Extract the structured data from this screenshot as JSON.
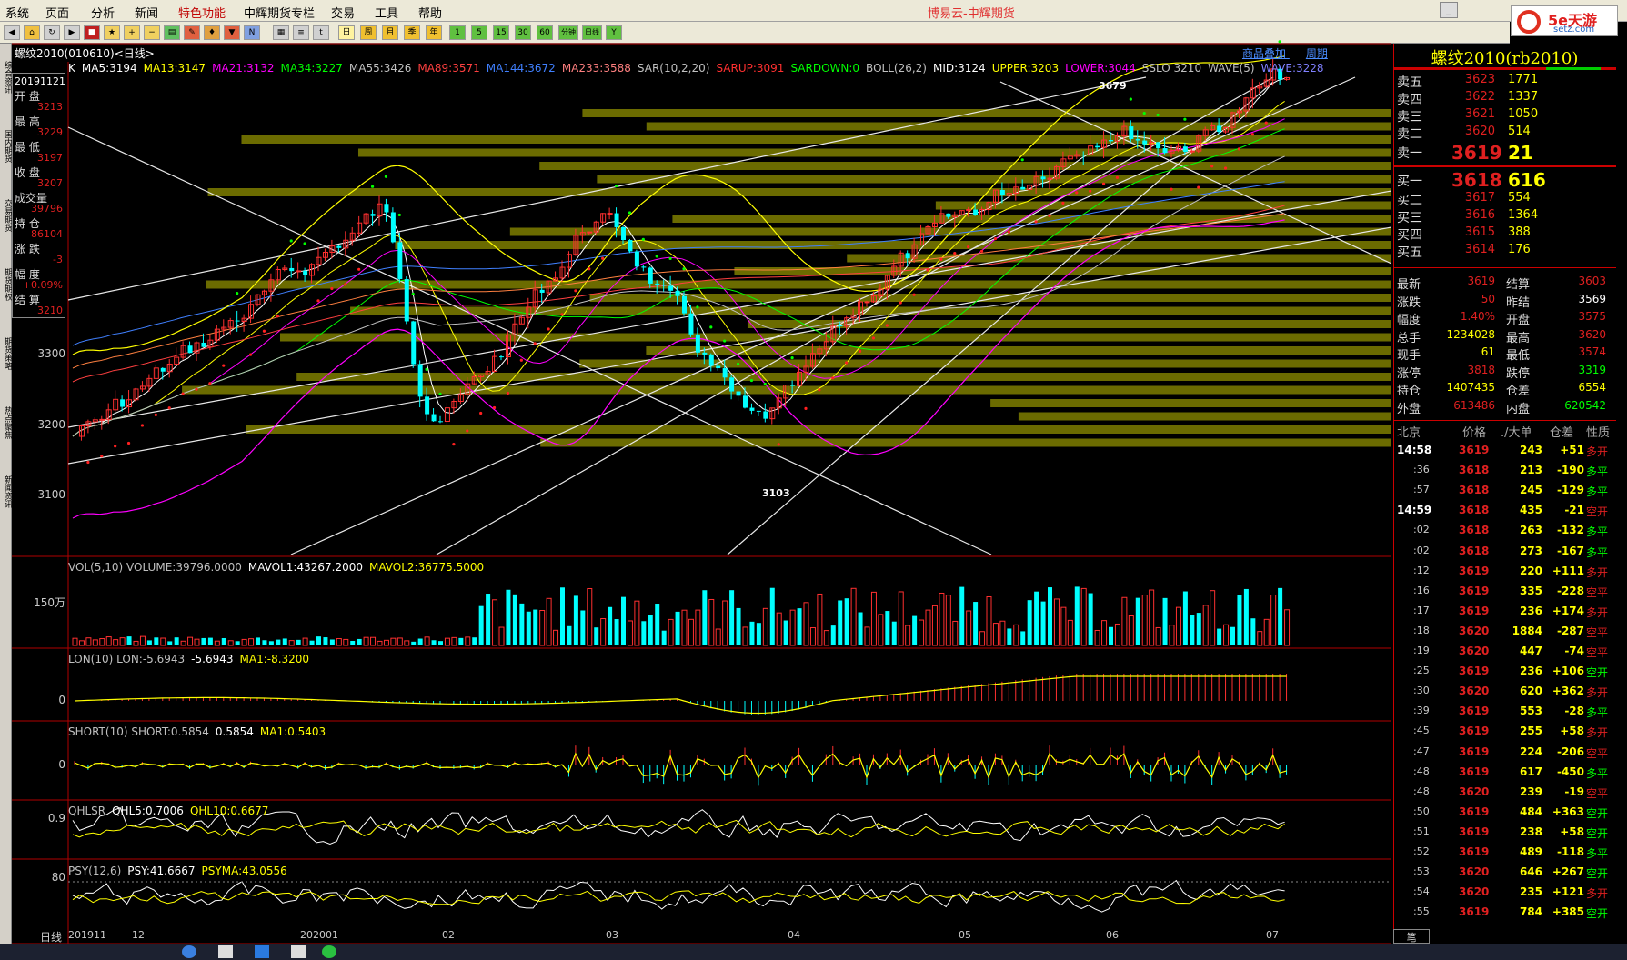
{
  "app": {
    "menus": [
      "系统",
      "页面",
      "分析",
      "新闻",
      "特色功能",
      "中辉期货专栏",
      "交易",
      "工具",
      "帮助"
    ],
    "title": "博易云-中辉期货",
    "logo_main": "5e天游",
    "logo_sub": "setz.com"
  },
  "toolbar": {
    "buttons": [
      "日",
      "周",
      "月",
      "季",
      "年",
      "1",
      "5",
      "15",
      "30",
      "60",
      "分钟",
      "日线"
    ]
  },
  "side_tabs": [
    "综合资讯",
    "国内期货",
    "交易期货",
    "期货期权",
    "期货策略",
    "热点聚焦",
    "新闻资讯"
  ],
  "chart": {
    "title": "螺纹2010(010610)<日线>",
    "links": [
      "商品叠加",
      "周期"
    ],
    "info_panel": {
      "date": "20191121",
      "rows": [
        {
          "label": "开  盘",
          "value": "3213"
        },
        {
          "label": "最  高",
          "value": "3229"
        },
        {
          "label": "最  低",
          "value": "3197"
        },
        {
          "label": "收  盘",
          "value": "3207"
        },
        {
          "label": "成交量",
          "value": "39796"
        },
        {
          "label": "持  仓",
          "value": "86104"
        },
        {
          "label": "涨  跌",
          "value": "-3"
        },
        {
          "label": "幅  度",
          "value": "+0.09%"
        },
        {
          "label": "结  算",
          "value": "3210"
        }
      ]
    },
    "main_indicators": [
      {
        "text": "K",
        "color": "#ffffff"
      },
      {
        "text": "MA5:3194",
        "color": "#ffffff"
      },
      {
        "text": "MA13:3147",
        "color": "#ffff00"
      },
      {
        "text": "MA21:3132",
        "color": "#ff00ff"
      },
      {
        "text": "MA34:3227",
        "color": "#00ff00"
      },
      {
        "text": "MA55:3426",
        "color": "#c0c0c0"
      },
      {
        "text": "MA89:3571",
        "color": "#ff4040"
      },
      {
        "text": "MA144:3672",
        "color": "#4080ff"
      },
      {
        "text": "MA233:3588",
        "color": "#ff8080"
      },
      {
        "text": "SAR(10,2,20)",
        "color": "#c0c0c0"
      },
      {
        "text": "SARUP:3091",
        "color": "#ff3030"
      },
      {
        "text": "SARDOWN:0",
        "color": "#00ff00"
      },
      {
        "text": "BOLL(26,2)",
        "color": "#c0c0c0"
      },
      {
        "text": "MID:3124",
        "color": "#ffffff"
      },
      {
        "text": "UPPER:3203",
        "color": "#ffff00"
      },
      {
        "text": "LOWER:3044",
        "color": "#ff00ff"
      },
      {
        "text": "SSLO 3210",
        "color": "#c0c0c0"
      },
      {
        "text": "WAVE(5)",
        "color": "#c0c0c0"
      },
      {
        "text": "WAVE:3228",
        "color": "#8080ff"
      }
    ],
    "price_axis": [
      "3300",
      "3200",
      "3100"
    ],
    "annotations": [
      "3679",
      "3103"
    ],
    "vol_label": [
      {
        "text": "VOL(5,10) VOLUME:39796.0000",
        "color": "#c0c0c0"
      },
      {
        "text": "MAVOL1:43267.2000",
        "color": "#ffffff"
      },
      {
        "text": "MAVOL2:36775.5000",
        "color": "#ffff00"
      }
    ],
    "vol_axis": "150万",
    "lon_label": [
      {
        "text": "LON(10) LON:-5.6943",
        "color": "#c0c0c0"
      },
      {
        "text": "-5.6943",
        "color": "#ffffff"
      },
      {
        "text": "MA1:-8.3200",
        "color": "#ffff00"
      }
    ],
    "lon_axis": "0",
    "short_label": [
      {
        "text": "SHORT(10) SHORT:0.5854",
        "color": "#c0c0c0"
      },
      {
        "text": "0.5854",
        "color": "#ffffff"
      },
      {
        "text": "MA1:0.5403",
        "color": "#ffff00"
      }
    ],
    "short_axis": "0",
    "qhl_label": [
      {
        "text": "QHLSR",
        "color": "#c0c0c0"
      },
      {
        "text": "QHL5:0.7006",
        "color": "#ffffff"
      },
      {
        "text": "QHL10:0.6677",
        "color": "#ffff00"
      }
    ],
    "qhl_axis": "0.9",
    "psy_label": [
      {
        "text": "PSY(12,6)",
        "color": "#c0c0c0"
      },
      {
        "text": "PSY:41.6667",
        "color": "#ffffff"
      },
      {
        "text": "PSYMA:43.0556",
        "color": "#ffff00"
      }
    ],
    "psy_axis": "80",
    "x_axis_label": "日线",
    "x_ticks": [
      "201911",
      "12",
      "202001",
      "02",
      "03",
      "04",
      "05",
      "06",
      "07"
    ]
  },
  "quote": {
    "title": "螺纹2010(rb2010)",
    "asks": [
      {
        "label": "卖五",
        "price": "3623",
        "vol": "1771"
      },
      {
        "label": "卖四",
        "price": "3622",
        "vol": "1337"
      },
      {
        "label": "卖三",
        "price": "3621",
        "vol": "1050"
      },
      {
        "label": "卖二",
        "price": "3620",
        "vol": "514"
      },
      {
        "label": "卖一",
        "price": "3619",
        "vol": "21"
      }
    ],
    "bids": [
      {
        "label": "买一",
        "price": "3618",
        "vol": "616"
      },
      {
        "label": "买二",
        "price": "3617",
        "vol": "554"
      },
      {
        "label": "买三",
        "price": "3616",
        "vol": "1364"
      },
      {
        "label": "买四",
        "price": "3615",
        "vol": "388"
      },
      {
        "label": "买五",
        "price": "3614",
        "vol": "176"
      }
    ],
    "stats": [
      {
        "l1": "最新",
        "v1": "3619",
        "c1": "#e02020",
        "l2": "结算",
        "v2": "3603",
        "c2": "#e02020"
      },
      {
        "l1": "涨跌",
        "v1": "50",
        "c1": "#e02020",
        "l2": "昨结",
        "v2": "3569",
        "c2": "#ffffff"
      },
      {
        "l1": "幅度",
        "v1": "1.40%",
        "c1": "#e02020",
        "l2": "开盘",
        "v2": "3575",
        "c2": "#e02020"
      },
      {
        "l1": "总手",
        "v1": "1234028",
        "c1": "#ffff00",
        "l2": "最高",
        "v2": "3620",
        "c2": "#e02020"
      },
      {
        "l1": "现手",
        "v1": "61",
        "c1": "#ffff00",
        "l2": "最低",
        "v2": "3574",
        "c2": "#e02020"
      },
      {
        "l1": "涨停",
        "v1": "3818",
        "c1": "#e02020",
        "l2": "跌停",
        "v2": "3319",
        "c2": "#00ff00"
      },
      {
        "l1": "持仓",
        "v1": "1407435",
        "c1": "#ffff00",
        "l2": "仓差",
        "v2": "6554",
        "c2": "#ffff00"
      },
      {
        "l1": "外盘",
        "v1": "613486",
        "c1": "#e02020",
        "l2": "内盘",
        "v2": "620542",
        "c2": "#00ff00"
      }
    ],
    "trade_header": [
      "北京",
      "价格",
      "./大单",
      "仓差",
      "性质"
    ],
    "trades": [
      {
        "t": "14:58",
        "p": "3619",
        "v": "243",
        "d": "+51",
        "n": "多开",
        "nc": "#e02020"
      },
      {
        "t": ":36",
        "p": "3618",
        "v": "213",
        "d": "-190",
        "n": "多平",
        "nc": "#00ff00"
      },
      {
        "t": ":57",
        "p": "3618",
        "v": "245",
        "d": "-129",
        "n": "多平",
        "nc": "#00ff00"
      },
      {
        "t": "14:59",
        "p": "3618",
        "v": "435",
        "d": "-21",
        "n": "空开",
        "nc": "#e02020"
      },
      {
        "t": ":02",
        "p": "3618",
        "v": "263",
        "d": "-132",
        "n": "多平",
        "nc": "#00ff00"
      },
      {
        "t": ":02",
        "p": "3618",
        "v": "273",
        "d": "-167",
        "n": "多平",
        "nc": "#00ff00"
      },
      {
        "t": ":12",
        "p": "3619",
        "v": "220",
        "d": "+111",
        "n": "多开",
        "nc": "#e02020"
      },
      {
        "t": ":16",
        "p": "3619",
        "v": "335",
        "d": "-228",
        "n": "空平",
        "nc": "#e02020"
      },
      {
        "t": ":17",
        "p": "3619",
        "v": "236",
        "d": "+174",
        "n": "多开",
        "nc": "#e02020"
      },
      {
        "t": ":18",
        "p": "3620",
        "v": "1884",
        "d": "-287",
        "n": "空平",
        "nc": "#e02020"
      },
      {
        "t": ":19",
        "p": "3620",
        "v": "447",
        "d": "-74",
        "n": "空平",
        "nc": "#e02020"
      },
      {
        "t": ":25",
        "p": "3619",
        "v": "236",
        "d": "+106",
        "n": "空开",
        "nc": "#00ff00"
      },
      {
        "t": ":30",
        "p": "3620",
        "v": "620",
        "d": "+362",
        "n": "多开",
        "nc": "#e02020"
      },
      {
        "t": ":39",
        "p": "3619",
        "v": "553",
        "d": "-28",
        "n": "多平",
        "nc": "#00ff00"
      },
      {
        "t": ":45",
        "p": "3619",
        "v": "255",
        "d": "+58",
        "n": "多开",
        "nc": "#e02020"
      },
      {
        "t": ":47",
        "p": "3619",
        "v": "224",
        "d": "-206",
        "n": "空平",
        "nc": "#e02020"
      },
      {
        "t": ":48",
        "p": "3619",
        "v": "617",
        "d": "-450",
        "n": "多平",
        "nc": "#00ff00"
      },
      {
        "t": ":48",
        "p": "3620",
        "v": "239",
        "d": "-19",
        "n": "空平",
        "nc": "#e02020"
      },
      {
        "t": ":50",
        "p": "3619",
        "v": "484",
        "d": "+363",
        "n": "空开",
        "nc": "#00ff00"
      },
      {
        "t": ":51",
        "p": "3619",
        "v": "238",
        "d": "+58",
        "n": "空开",
        "nc": "#00ff00"
      },
      {
        "t": ":52",
        "p": "3619",
        "v": "489",
        "d": "-118",
        "n": "多平",
        "nc": "#00ff00"
      },
      {
        "t": ":53",
        "p": "3620",
        "v": "646",
        "d": "+267",
        "n": "空开",
        "nc": "#00ff00"
      },
      {
        "t": ":54",
        "p": "3620",
        "v": "235",
        "d": "+121",
        "n": "多开",
        "nc": "#e02020"
      },
      {
        "t": ":55",
        "p": "3619",
        "v": "784",
        "d": "+385",
        "n": "空开",
        "nc": "#00ff00"
      }
    ],
    "bottom_tab": "笔"
  }
}
